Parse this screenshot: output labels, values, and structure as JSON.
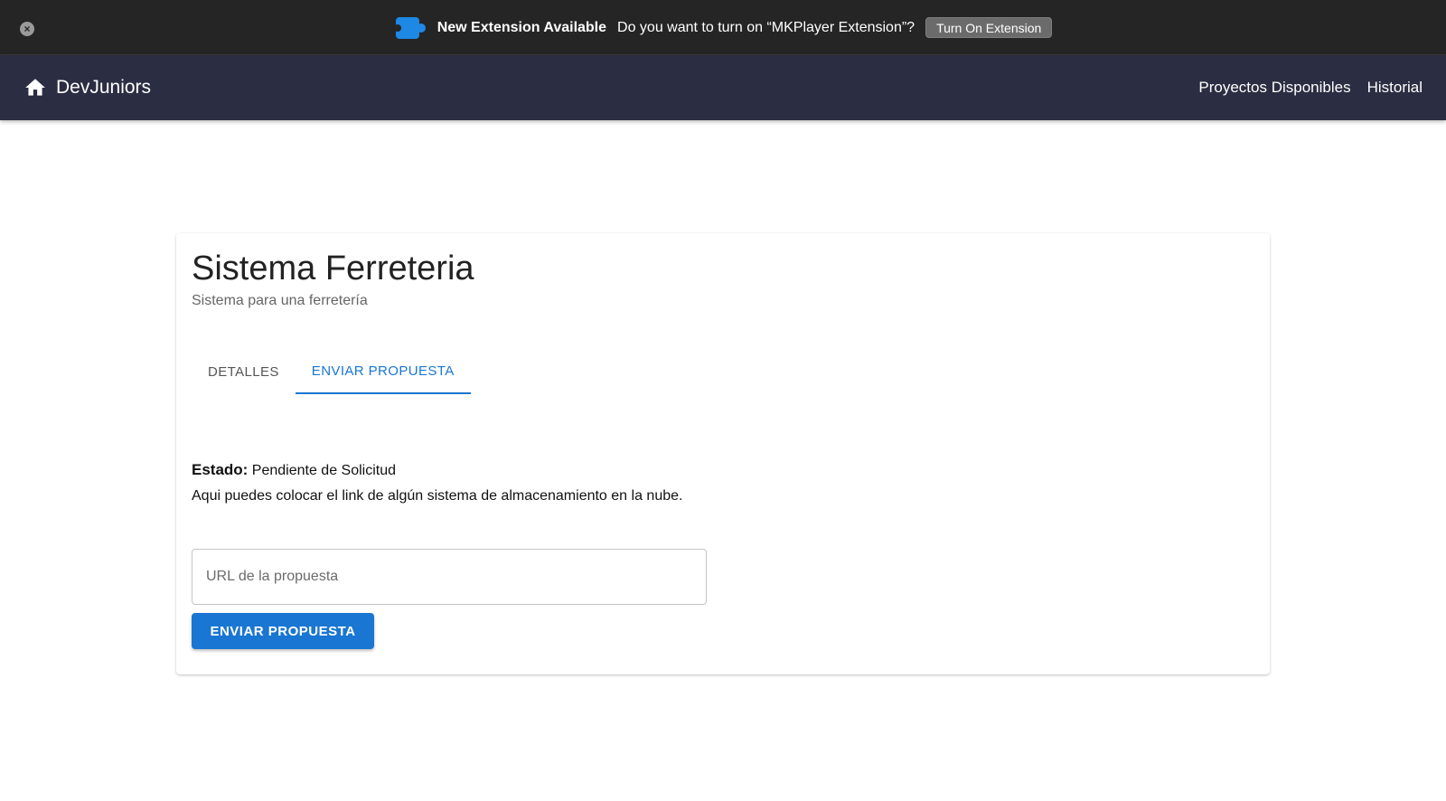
{
  "extension_banner": {
    "close_icon": "close-icon",
    "icon": "puzzle-piece-icon",
    "title": "New Extension Available",
    "question": "Do you want to turn on “MKPlayer Extension”?",
    "button_label": "Turn On Extension",
    "colors": {
      "background": "#252525",
      "icon": "#1e88e5",
      "button": "#6b6b6b"
    }
  },
  "appbar": {
    "brand_icon": "home-icon",
    "brand": "DevJuniors",
    "nav": [
      {
        "label": "Proyectos Disponibles"
      },
      {
        "label": "Historial"
      }
    ],
    "colors": {
      "background": "#2b2d42"
    }
  },
  "card": {
    "title": "Sistema Ferreteria",
    "subtitle": "Sistema para una ferretería",
    "tabs": [
      {
        "label": "DETALLES",
        "active": false
      },
      {
        "label": "ENVIAR PROPUESTA",
        "active": true
      }
    ],
    "status": {
      "label": "Estado:",
      "value": "Pendiente de Solicitud"
    },
    "help_text": "Aqui puedes colocar el link de algún sistema de almacenamiento en la nube.",
    "url_input": {
      "placeholder": "URL de la propuesta",
      "value": ""
    },
    "submit_label": "ENVIAR PROPUESTA",
    "colors": {
      "accent": "#1976d2"
    }
  }
}
